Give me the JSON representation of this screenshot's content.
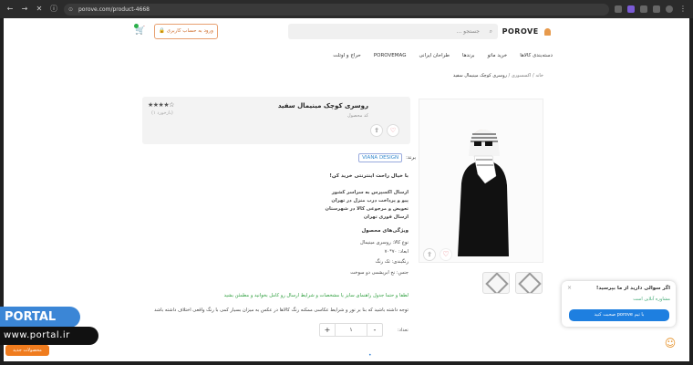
{
  "browser": {
    "url": "porove.com/product-4668"
  },
  "header": {
    "logo": "POROVE",
    "search_placeholder": "جستجو ...",
    "login_label": "ورود به حساب کاربری"
  },
  "menu": {
    "items": [
      "دسته‌بندی کالاها",
      "خرید ماتو",
      "برندها",
      "طراحان ایرانی",
      "POROVEMAG",
      "حراج و اوتلت"
    ]
  },
  "breadcrumb": {
    "home": "خانه",
    "mid": "اکسسوری",
    "current": "روسری کوچک مینیمال سفید"
  },
  "product": {
    "title": "روسری کوچک مینیمال سفید",
    "code": "کد محصول",
    "stars": "★★★★☆",
    "reviews": "(بازخورد ۱)",
    "brand_label": "برند:",
    "brand": "VIANA DESIGN",
    "shipping_title": "با خیال راحت اینترنتی خرید کن!",
    "benefits": [
      "ارسال اکسپرس به سراسر کشور",
      "پیو و پرداخت درب منزل در تهران",
      "تعویض و مرجوعی کالا در شهرستان",
      "ارسال فوری تهران"
    ],
    "features_title": "ویژگی‌های محصول",
    "features": [
      "نوع کالا: روسری مینیمال",
      "ابعاد: ۷۰*۷۰",
      "رنگبندی: تک رنگ",
      "جنس: نخ ابریشمی دو سوخت"
    ],
    "notice_green": "لطفا و حتما جدول راهنمای سایز یا مشخصات و شرایط ارسال رو کامل بخوانید و مطمئن بشید",
    "notice": "توجه داشته باشید که بنا بر نور و شرایط عکاسی ممکنه رنگ کالاها در عکس به میزان بسیار کمی با رنگ واقعی اختلاف داشته باشد",
    "qty_label": "تعداد:",
    "qty_value": "۱",
    "plus": "+",
    "minus": "-"
  },
  "chat": {
    "question": "اگر سوالی دارید از ما بپرسید!",
    "online": "مشاوره آنلاین است",
    "button": "با تیم porove صحبت کنید"
  },
  "watermark": {
    "portal": "PORTAL",
    "site": "www.portal.ir",
    "badge": "محصولات جدید"
  }
}
